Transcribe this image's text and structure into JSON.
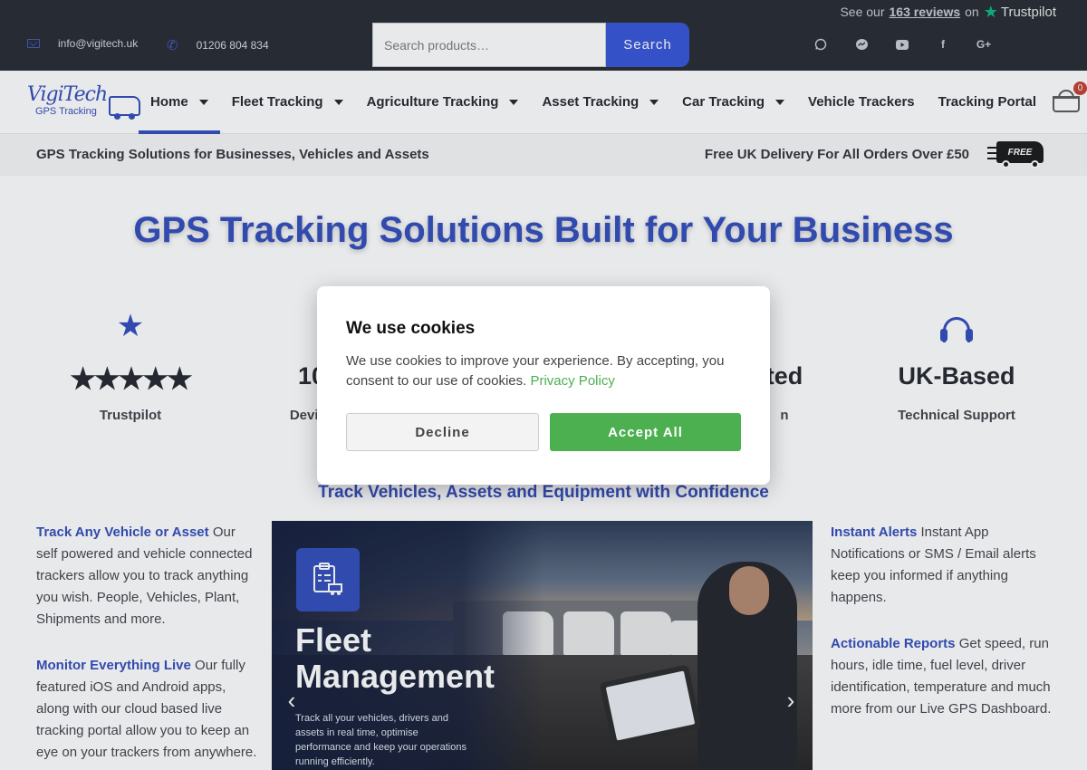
{
  "topbar": {
    "review_prefix": "See our",
    "review_count": "163 reviews",
    "review_suffix": "on",
    "review_brand": "Trustpilot",
    "email": "info@vigitech.uk",
    "phone": "01206 804 834",
    "search_placeholder": "Search products…",
    "search_button": "Search",
    "social_icons": [
      "whatsapp-icon",
      "messenger-icon",
      "youtube-icon",
      "facebook-icon",
      "google-plus-icon"
    ],
    "gplus_label": "G+"
  },
  "logo": {
    "line1": "VigiTech",
    "line2": "GPS Tracking"
  },
  "nav": {
    "items": [
      {
        "label": "Home",
        "dropdown": true
      },
      {
        "label": "Fleet Tracking",
        "dropdown": true
      },
      {
        "label": "Agriculture Tracking",
        "dropdown": true
      },
      {
        "label": "Asset Tracking",
        "dropdown": true
      },
      {
        "label": "Car Tracking",
        "dropdown": true
      },
      {
        "label": "Vehicle Trackers",
        "dropdown": false
      },
      {
        "label": "Tracking Portal",
        "dropdown": false
      }
    ],
    "cart_count": "0"
  },
  "strip": {
    "left": "GPS Tracking Solutions for Businesses, Vehicles and Assets",
    "right": "Free UK Delivery For All Orders Over £50",
    "van_label": "FREE"
  },
  "hero": {
    "title": "GPS Tracking Solutions Built for Your Business"
  },
  "features": [
    {
      "big": "★★★★★",
      "sub": "Trustpilot"
    },
    {
      "big": "10",
      "sub": "Device"
    },
    {
      "big": "ted",
      "sub": "n"
    },
    {
      "big": "UK-Based",
      "sub": "Technical Support"
    }
  ],
  "section": {
    "subtitle": "Track Vehicles, Assets and Equipment with Confidence"
  },
  "left_col": [
    {
      "hl": "Track Any Vehicle or Asset",
      "text": " Our self powered and vehicle connected trackers allow you to track anything you wish. People, Vehicles, Plant, Shipments and more."
    },
    {
      "hl": "Monitor Everything Live",
      "text": " Our fully featured iOS and Android apps, along with our cloud based live tracking portal allow you to keep an eye on your trackers from anywhere."
    }
  ],
  "right_col": [
    {
      "hl": "Instant Alerts",
      "text": " Instant App Notifications or SMS / Email alerts keep you informed if anything happens."
    },
    {
      "hl": "Actionable Reports",
      "text": " Get speed, run hours, idle time, fuel level, driver identification, temperature and much more from our Live GPS Dashboard."
    }
  ],
  "slide": {
    "title_line1": "Fleet",
    "title_line2": "Management",
    "desc": "Track all your vehicles, drivers and assets in real time, optimise performance and keep your operations running efficiently."
  },
  "cookie": {
    "title": "We use cookies",
    "message": "We use cookies to improve your experience. By accepting, you consent to our use of cookies.",
    "policy_link": "Privacy Policy",
    "decline": "Decline",
    "accept": "Accept All"
  }
}
